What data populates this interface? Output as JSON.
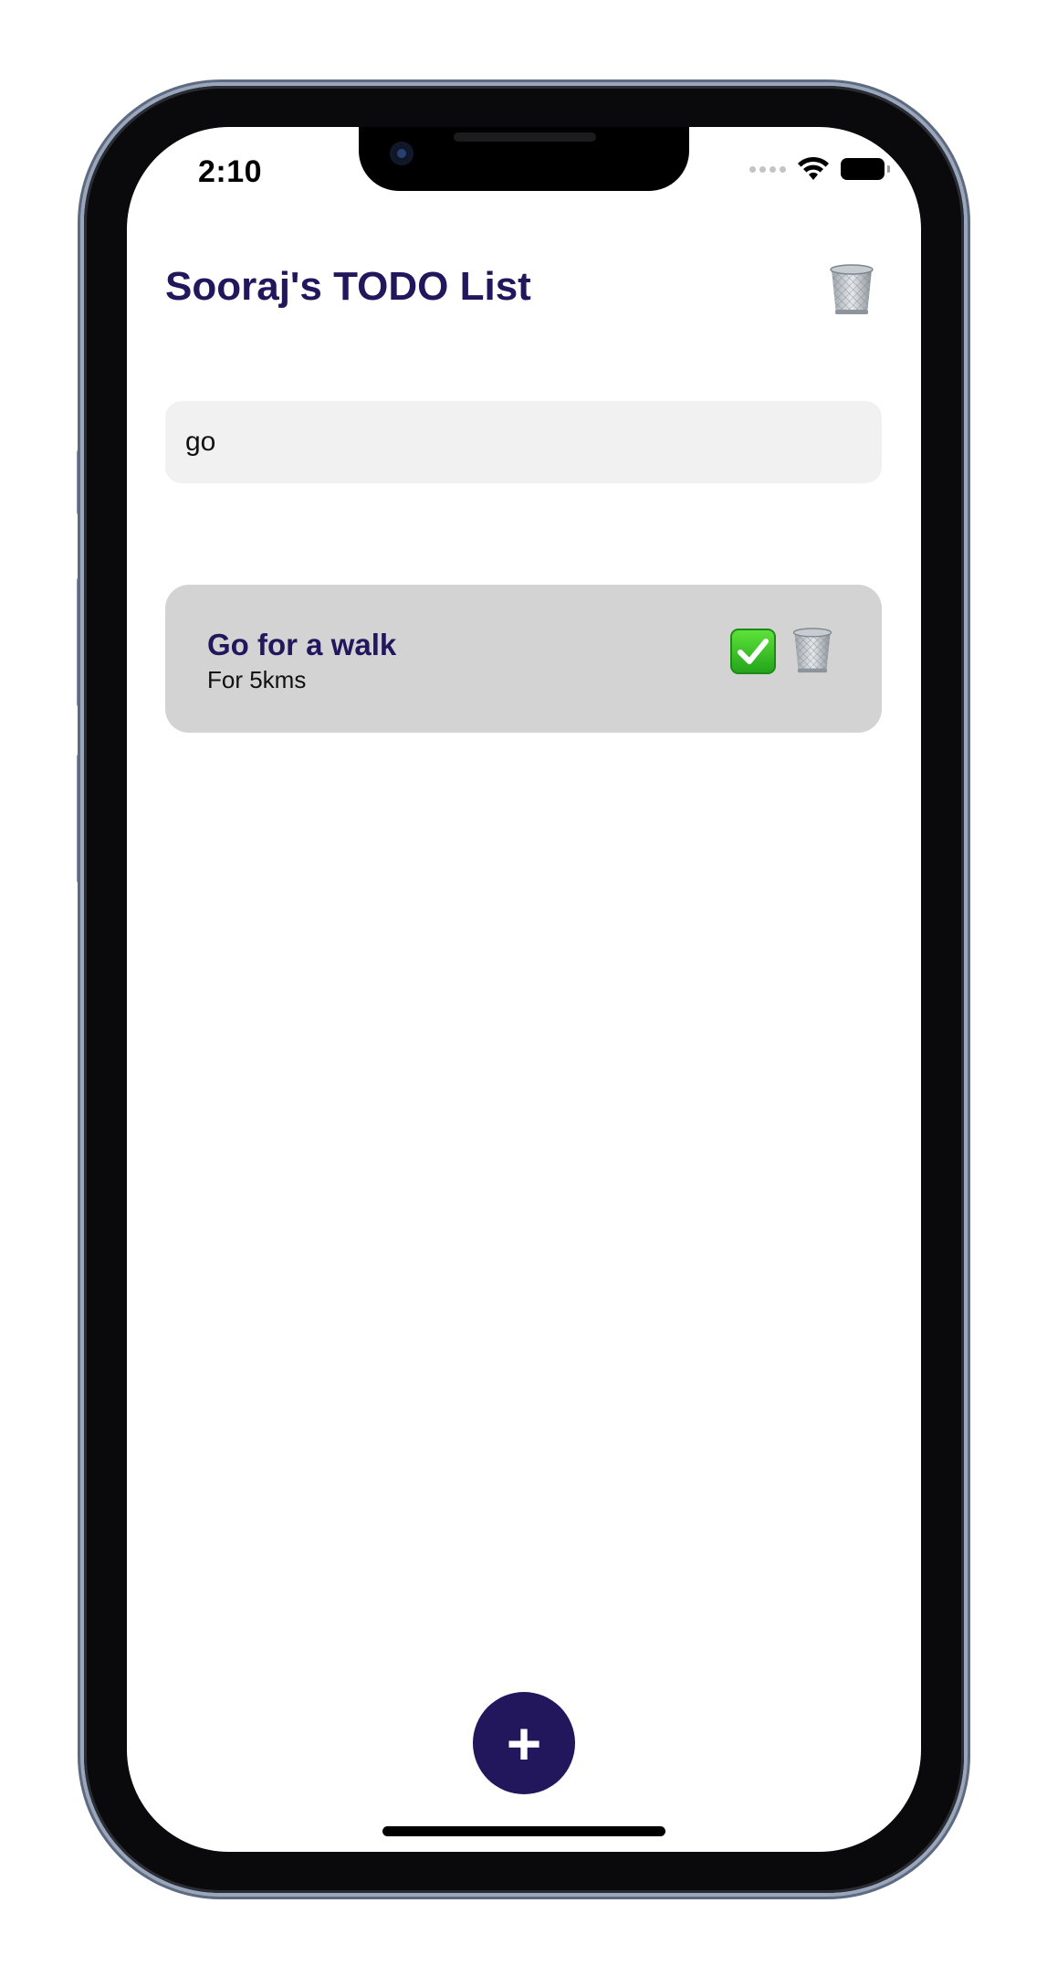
{
  "status_bar": {
    "time": "2:10"
  },
  "header": {
    "title": "Sooraj's TODO List"
  },
  "search": {
    "value": "go"
  },
  "todos": [
    {
      "title": "Go for a walk",
      "description": "For 5kms",
      "completed": true
    }
  ],
  "fab": {
    "label": "+"
  },
  "icons": {
    "header_action": "trash-icon",
    "todo_complete": "check-icon",
    "todo_delete": "trash-icon",
    "wifi": "wifi-icon",
    "battery": "battery-icon",
    "cellular": "cellular-signal-icon"
  },
  "colors": {
    "accent": "#22175c",
    "card": "#d3d3d3",
    "input": "#f1f1f1",
    "check": "#2fbf1f"
  }
}
